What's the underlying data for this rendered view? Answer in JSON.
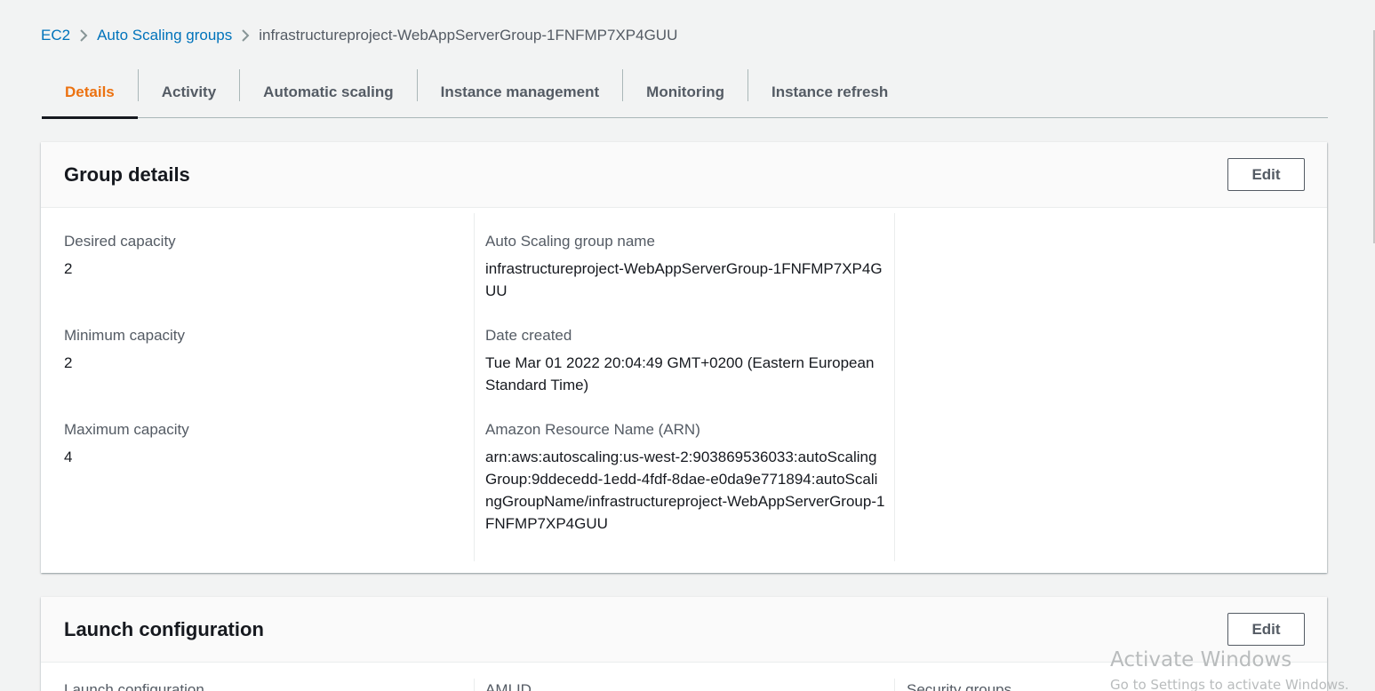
{
  "breadcrumb": {
    "items": [
      "EC2",
      "Auto Scaling groups"
    ],
    "current": "infrastructureproject-WebAppServerGroup-1FNFMP7XP4GUU"
  },
  "tabs": [
    "Details",
    "Activity",
    "Automatic scaling",
    "Instance management",
    "Monitoring",
    "Instance refresh"
  ],
  "active_tab": "Details",
  "group_details": {
    "title": "Group details",
    "edit_label": "Edit",
    "desired_capacity": {
      "label": "Desired capacity",
      "value": "2"
    },
    "minimum_capacity": {
      "label": "Minimum capacity",
      "value": "2"
    },
    "maximum_capacity": {
      "label": "Maximum capacity",
      "value": "4"
    },
    "group_name": {
      "label": "Auto Scaling group name",
      "value": "infrastructureproject-WebAppServerGroup-1FNFMP7XP4GUU"
    },
    "date_created": {
      "label": "Date created",
      "value": "Tue Mar 01 2022 20:04:49 GMT+0200 (Eastern European Standard Time)"
    },
    "arn": {
      "label": "Amazon Resource Name (ARN)",
      "value": "arn:aws:autoscaling:us-west-2:903869536033:autoScalingGroup:9ddecedd-1edd-4fdf-8dae-e0da9e771894:autoScalingGroupName/infrastructureproject-WebAppServerGroup-1FNFMP7XP4GUU"
    }
  },
  "launch_configuration": {
    "title": "Launch configuration",
    "edit_label": "Edit",
    "col_labels": [
      "Launch configuration",
      "AMI ID",
      "Security groups"
    ]
  },
  "watermark": {
    "line1": "Activate Windows",
    "line2": "Go to Settings to activate Windows."
  },
  "colors": {
    "link": "#0073bb",
    "active_tab": "#ec7211",
    "background": "#f2f3f3"
  }
}
